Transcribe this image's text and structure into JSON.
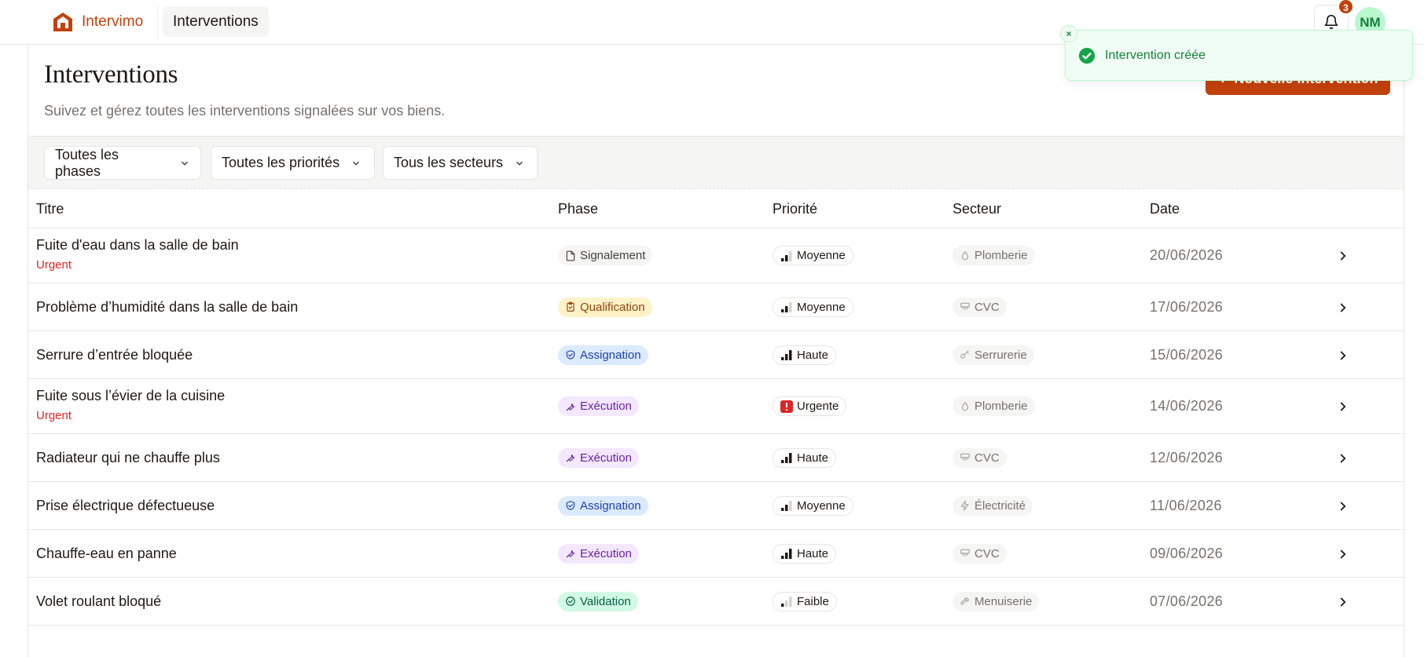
{
  "app": {
    "name": "Intervimo",
    "nav_tab": "Interventions",
    "notifications_count": "3",
    "user_initials": "NM"
  },
  "page": {
    "title": "Interventions",
    "subtitle": "Suivez et gérez toutes les interventions signalées sur vos biens.",
    "new_button_label": "Nouvelle intervention"
  },
  "filters": {
    "phase": "Toutes les phases",
    "priority": "Toutes les priorités",
    "sector": "Tous les secteurs"
  },
  "table": {
    "headers": {
      "title": "Titre",
      "phase": "Phase",
      "priority": "Priorité",
      "sector": "Secteur",
      "date": "Date"
    },
    "rows": [
      {
        "title": "Fuite d'eau dans la salle de bain",
        "flag": "Urgent",
        "phase": "Signalement",
        "phase_icon": "file-icon",
        "priority": "Moyenne",
        "priority_icon": "signal-medium-icon",
        "sector": "Plomberie",
        "sector_icon": "droplet-icon",
        "date": "20/06/2026"
      },
      {
        "title": "Problème d’humidité dans la salle de bain",
        "flag": "",
        "phase": "Qualification",
        "phase_icon": "clipboard-icon",
        "priority": "Moyenne",
        "priority_icon": "signal-medium-icon",
        "sector": "CVC",
        "sector_icon": "fan-icon",
        "date": "17/06/2026"
      },
      {
        "title": "Serrure d’entrée bloquée",
        "flag": "",
        "phase": "Assignation",
        "phase_icon": "handshake-icon",
        "priority": "Haute",
        "priority_icon": "signal-high-icon",
        "sector": "Serrurerie",
        "sector_icon": "key-icon",
        "date": "15/06/2026"
      },
      {
        "title": "Fuite sous l’évier de la cuisine",
        "flag": "Urgent",
        "phase": "Exécution",
        "phase_icon": "wrench-icon",
        "priority": "Urgente",
        "priority_icon": "alert-square-icon",
        "sector": "Plomberie",
        "sector_icon": "droplet-icon",
        "date": "14/06/2026"
      },
      {
        "title": "Radiateur qui ne chauffe plus",
        "flag": "",
        "phase": "Exécution",
        "phase_icon": "wrench-icon",
        "priority": "Haute",
        "priority_icon": "signal-high-icon",
        "sector": "CVC",
        "sector_icon": "fan-icon",
        "date": "12/06/2026"
      },
      {
        "title": "Prise électrique défectueuse",
        "flag": "",
        "phase": "Assignation",
        "phase_icon": "handshake-icon",
        "priority": "Moyenne",
        "priority_icon": "signal-medium-icon",
        "sector": "Électricité",
        "sector_icon": "zap-icon",
        "date": "11/06/2026"
      },
      {
        "title": "Chauffe-eau en panne",
        "flag": "",
        "phase": "Exécution",
        "phase_icon": "wrench-icon",
        "priority": "Haute",
        "priority_icon": "signal-high-icon",
        "sector": "CVC",
        "sector_icon": "fan-icon",
        "date": "09/06/2026"
      },
      {
        "title": "Volet roulant bloqué",
        "flag": "",
        "phase": "Validation",
        "phase_icon": "check-circle-icon",
        "priority": "Faible",
        "priority_icon": "signal-low-icon",
        "sector": "Menuiserie",
        "sector_icon": "hammer-icon",
        "date": "07/06/2026"
      }
    ]
  },
  "toast": {
    "message": "Intervention créée"
  },
  "colors": {
    "brand": "#c2410c",
    "urgent": "#dc2626",
    "success": "#15803d",
    "phase_signalement": "#f5f5f4",
    "phase_qualification": "#fef3c7",
    "phase_assignation": "#dbeafe",
    "phase_execution": "#f3e8ff",
    "phase_validation": "#d1fae5"
  }
}
